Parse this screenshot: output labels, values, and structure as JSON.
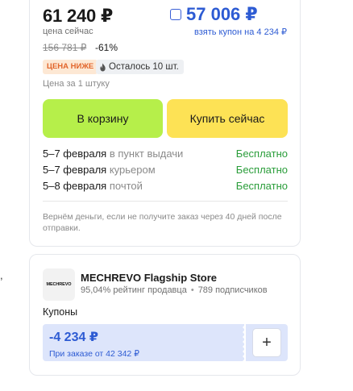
{
  "left_fragment": ",",
  "pricing": {
    "price": "61 240 ₽",
    "price_label": "цена сейчас",
    "coupon_checked": false,
    "coupon_price": "57 006 ₽",
    "coupon_label": "взять купон на 4 234 ₽",
    "old_price": "156 781 ₽",
    "discount": "-61%",
    "badge_low_price": "ЦЕНА НИЖЕ",
    "stock_icon": "fire-icon",
    "stock_text": "Осталось 10 шт.",
    "per_unit": "Цена за 1 штуку"
  },
  "actions": {
    "add_to_cart": "В корзину",
    "buy_now": "Купить сейчас"
  },
  "delivery": [
    {
      "date": "5–7 февраля",
      "method": "в пункт выдачи",
      "cost": "Бесплатно"
    },
    {
      "date": "5–7 февраля",
      "method": "курьером",
      "cost": "Бесплатно"
    },
    {
      "date": "5–8 февраля",
      "method": "почтой",
      "cost": "Бесплатно"
    }
  ],
  "refund_note": "Вернём деньги, если не получите заказ через 40 дней после отправки.",
  "seller": {
    "logo_text": "MECHREVO",
    "name": "MECHREVO Flagship Store",
    "rating": "95,04% рейтинг продавца",
    "separator": "•",
    "subscribers": "789 подписчиков"
  },
  "coupons": {
    "title": "Купоны",
    "amount": "-4 234 ₽",
    "condition": "При заказе от 42 342 ₽",
    "add_label": "+"
  },
  "colors": {
    "cart_button": "#b6ef4a",
    "buy_button": "#fde255",
    "coupon_blue": "#2d5bd3",
    "free_green": "#2a9d3a",
    "badge_orange": "#e2662c"
  }
}
